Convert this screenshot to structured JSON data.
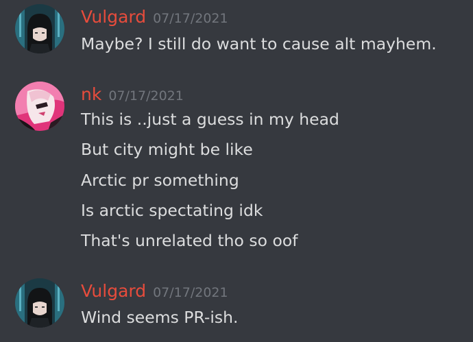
{
  "messages": [
    {
      "author": "Vulgard",
      "timestamp": "07/17/2021",
      "avatar_icon": "dark-haired-anime-avatar-icon",
      "lines": [
        "Maybe? I still do want to cause alt mayhem."
      ]
    },
    {
      "author": "nk",
      "timestamp": "07/17/2021",
      "avatar_icon": "pink-anime-avatar-icon",
      "lines": [
        "This is ..just a guess in my head",
        "But city might be like",
        "Arctic pr something",
        "Is arctic spectating idk",
        "That's unrelated tho so oof"
      ]
    },
    {
      "author": "Vulgard",
      "timestamp": "07/17/2021",
      "avatar_icon": "dark-haired-anime-avatar-icon",
      "lines": [
        "Wind seems PR-ish."
      ]
    }
  ],
  "colors": {
    "background": "#36393f",
    "username": "#e74c3c",
    "timestamp": "#72767d",
    "message_text": "#dcddde"
  }
}
